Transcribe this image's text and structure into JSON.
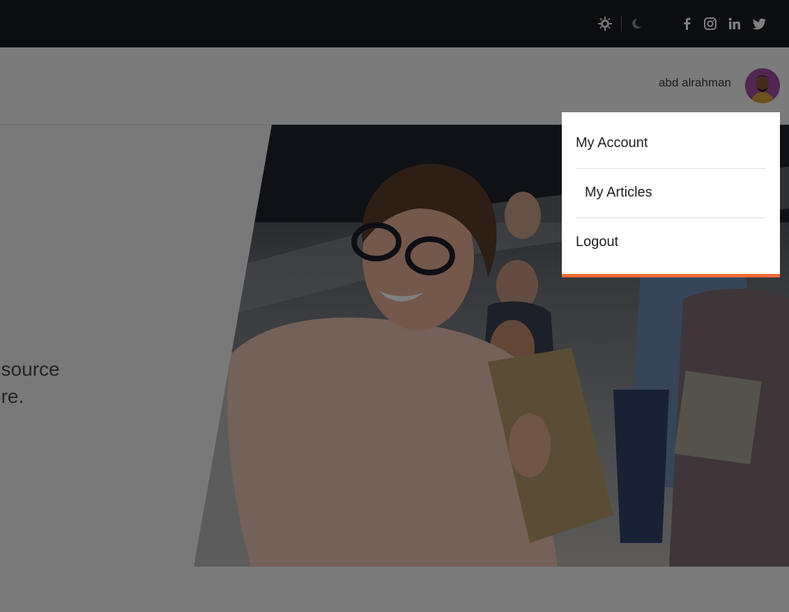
{
  "topbar": {
    "theme_icons": [
      "sun-gear-icon",
      "moon-icon"
    ],
    "social_icons": [
      "facebook-icon",
      "instagram-icon",
      "linkedin-icon",
      "twitter-icon"
    ]
  },
  "navbar": {
    "user_name": "abd alrahman"
  },
  "hero": {
    "text_fragment": "t source\nere."
  },
  "user_menu": {
    "items": [
      "My Account",
      "My Articles",
      "Logout"
    ]
  },
  "colors": {
    "topbar_bg": "#191b1f",
    "accent": "#f26b3a",
    "avatar_bg": "#a64aa2",
    "overlay": "rgba(0,0,0,0.5)"
  }
}
